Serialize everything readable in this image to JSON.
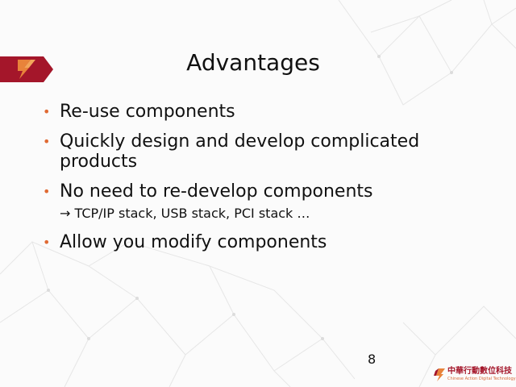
{
  "slide": {
    "title": "Advantages",
    "bullets": [
      "Re-use components",
      "Quickly design and develop complicated products",
      "No need to re-develop components",
      "Allow you modify components"
    ],
    "sub_point": "→ TCP/IP stack, USB stack, PCI stack …",
    "bullet_glyph": "•",
    "page_number": "8"
  },
  "footer": {
    "company_name": "中華行動數位科技",
    "company_tagline": "Chinese Action Digital Technology"
  },
  "colors": {
    "bullet": "#e06a33",
    "logo_red": "#a4162a",
    "logo_orange": "#e8833a"
  },
  "icons": {
    "corner_logo": "company-logo-mark",
    "footer_logo": "company-logo-mark"
  }
}
